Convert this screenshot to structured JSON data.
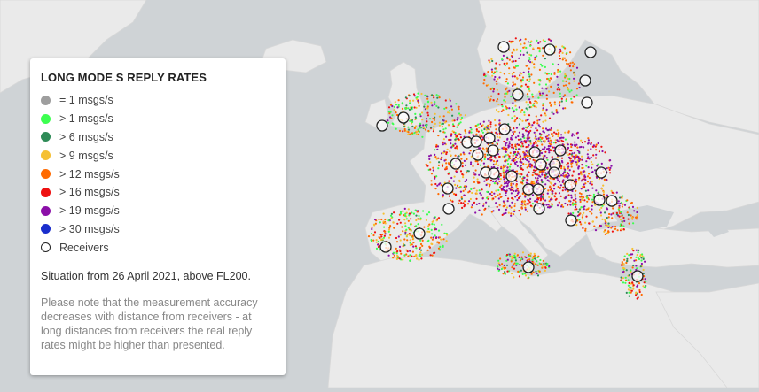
{
  "legend": {
    "title": "LONG MODE S REPLY RATES",
    "items": [
      {
        "label": "= 1 msgs/s",
        "color": "#9e9e9e"
      },
      {
        "label": "> 1 msgs/s",
        "color": "#3cff50"
      },
      {
        "label": "> 6 msgs/s",
        "color": "#2e8b57"
      },
      {
        "label": "> 9 msgs/s",
        "color": "#f5c033"
      },
      {
        "label": "> 12 msgs/s",
        "color": "#ff6a00"
      },
      {
        "label": "> 16 msgs/s",
        "color": "#ee1111"
      },
      {
        "label": "> 19 msgs/s",
        "color": "#8b0fa8"
      },
      {
        "label": "> 30 msgs/s",
        "color": "#1a2ecc"
      },
      {
        "label": "Receivers",
        "color": "ring"
      }
    ],
    "situation": "Situation from 26 April 2021, above FL200.",
    "note": "Please note that the measurement accuracy decreases with distance from receivers - at long distances from receivers the real reply rates might be higher than presented."
  }
}
